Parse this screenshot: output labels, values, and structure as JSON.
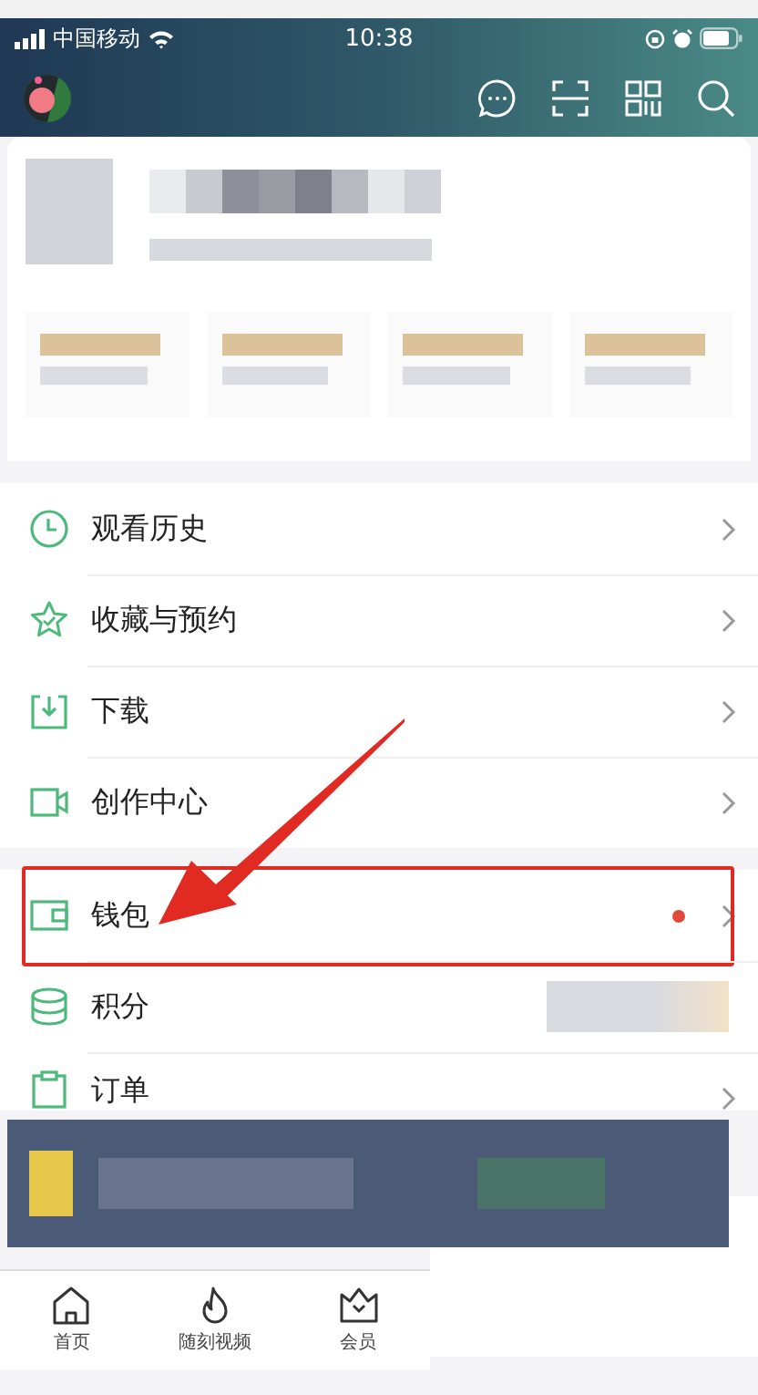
{
  "status_bar": {
    "carrier": "中国移动",
    "time": "10:38"
  },
  "menu_groups": [
    {
      "items": [
        {
          "kind": "clock",
          "label": "观看历史",
          "dot": false
        },
        {
          "kind": "star",
          "label": "收藏与预约",
          "dot": false
        },
        {
          "kind": "download",
          "label": "下载",
          "dot": false
        },
        {
          "kind": "camera",
          "label": "创作中心",
          "dot": false
        }
      ]
    },
    {
      "items": [
        {
          "kind": "wallet",
          "label": "钱包",
          "dot": true,
          "highlighted": true
        },
        {
          "kind": "coins",
          "label": "积分",
          "dot": false
        },
        {
          "kind": "clipboard",
          "label": "订单",
          "dot": false
        }
      ]
    }
  ],
  "tab_bar": [
    {
      "kind": "home",
      "label": "首页"
    },
    {
      "kind": "flame",
      "label": "随刻视频"
    },
    {
      "kind": "crown",
      "label": "会员"
    }
  ]
}
